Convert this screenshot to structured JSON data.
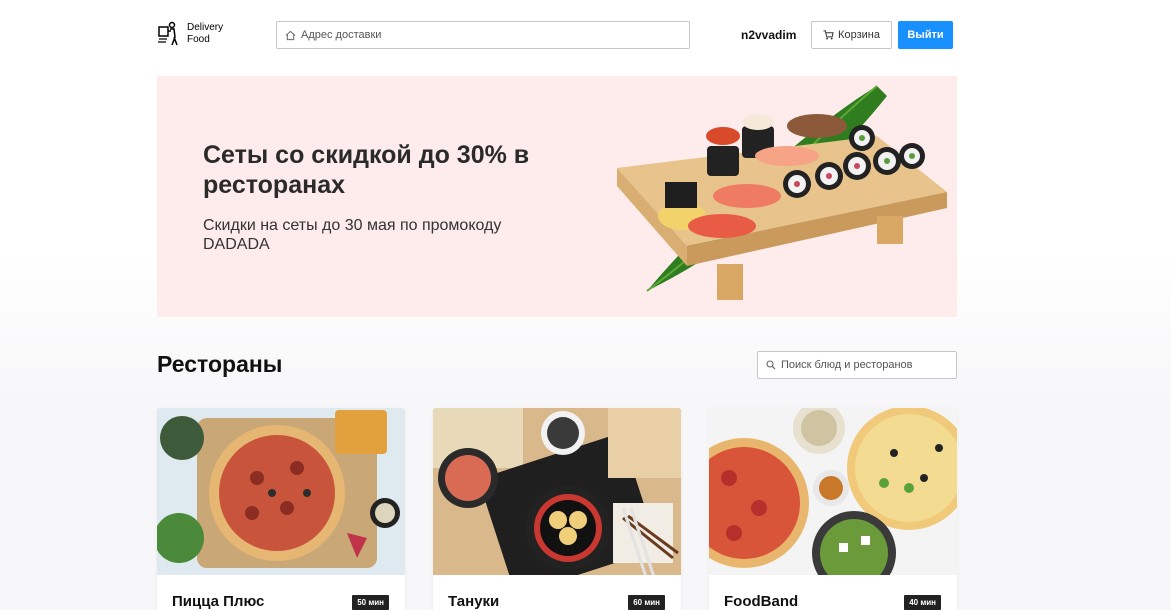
{
  "header": {
    "logo_line1": "Delivery",
    "logo_line2": "Food",
    "address_placeholder": "Адрес доставки",
    "username": "n2vvadim",
    "cart_label": "Корзина",
    "logout_label": "Выйти"
  },
  "promo": {
    "title": "Сеты со скидкой до 30% в ресторанах",
    "subtitle": "Скидки на сеты до 30 мая по промокоду DADADA"
  },
  "restaurants": {
    "title": "Рестораны",
    "search_placeholder": "Поиск блюд и ресторанов",
    "cards": [
      {
        "name": "Пицца Плюс",
        "time": "50 мин"
      },
      {
        "name": "Тануки",
        "time": "60 мин"
      },
      {
        "name": "FoodBand",
        "time": "40 мин"
      }
    ]
  },
  "colors": {
    "accent": "#1890ff",
    "promo_bg": "#fdeceb",
    "badge_bg": "#222222"
  },
  "icons": [
    "delivery-courier-icon",
    "home-icon",
    "cart-icon",
    "search-icon"
  ]
}
